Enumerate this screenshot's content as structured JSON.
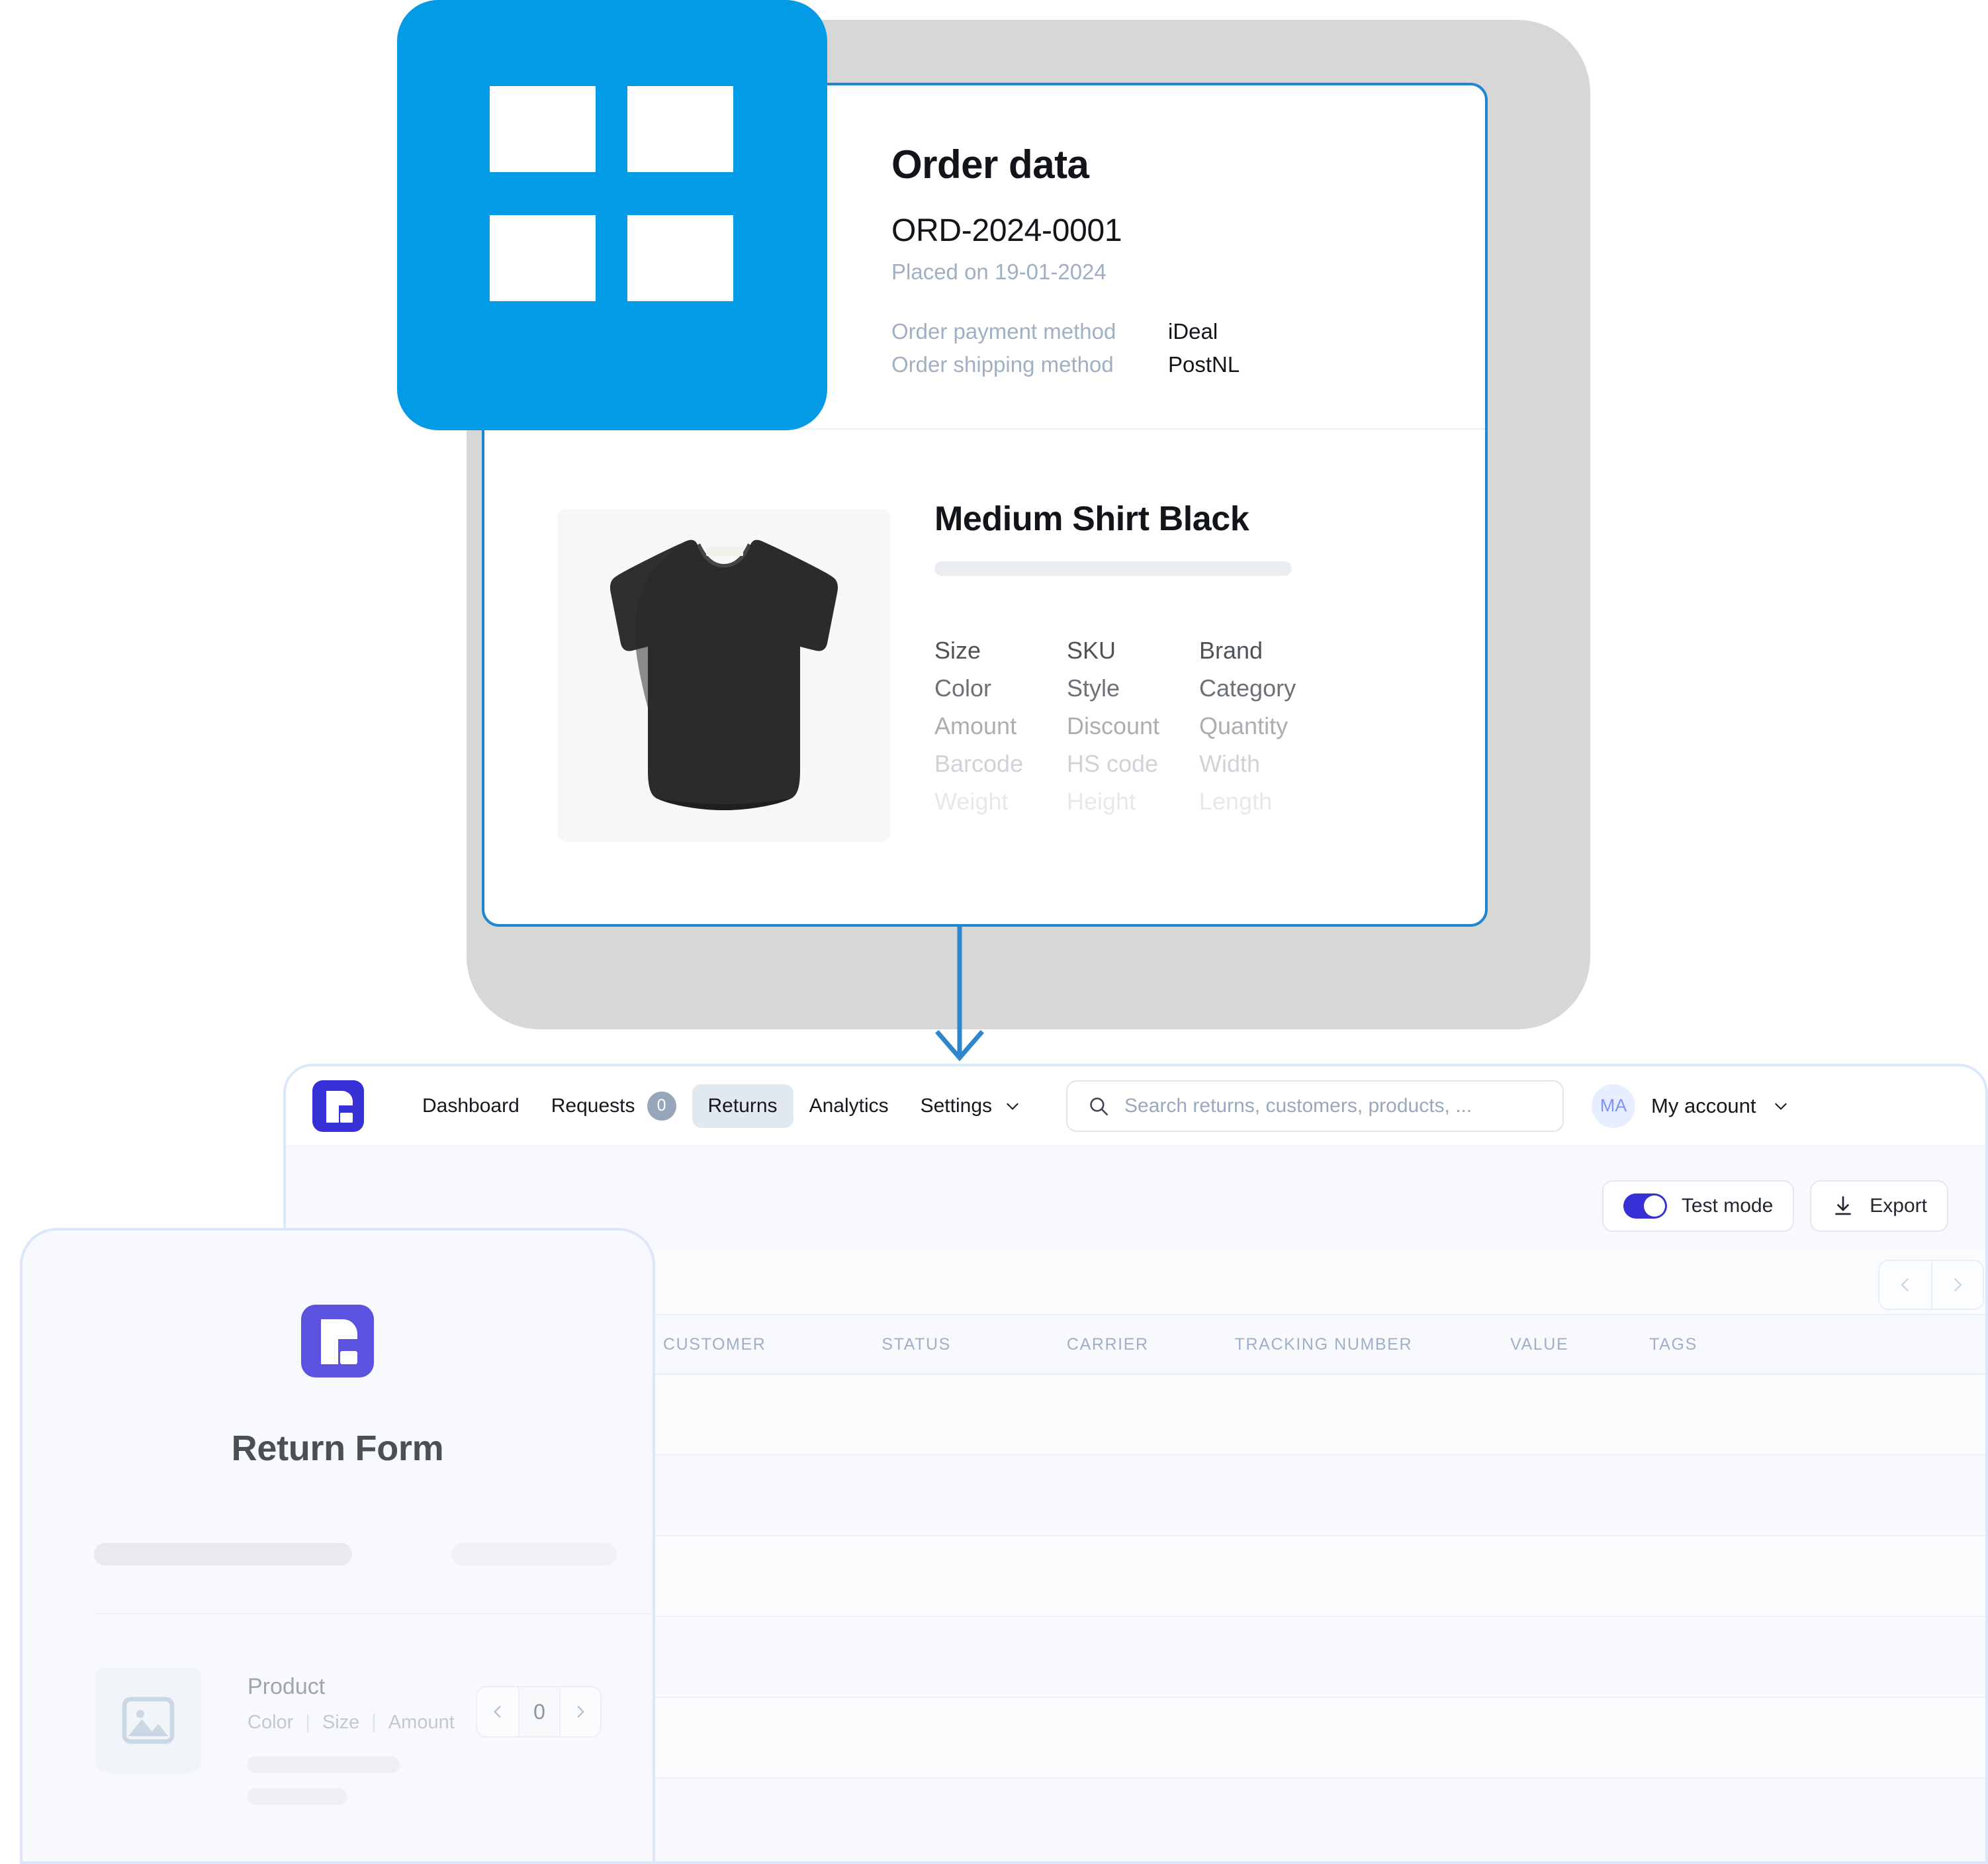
{
  "order_card": {
    "title": "Order data",
    "order_number": "ORD-2024-0001",
    "placed": "Placed on 19-01-2024",
    "meta": [
      {
        "key": "Order payment method",
        "value": "iDeal"
      },
      {
        "key": "Order shipping method",
        "value": "PostNL"
      }
    ],
    "product": {
      "name": "Medium Shirt Black",
      "attributes": [
        "Size",
        "SKU",
        "Brand",
        "Color",
        "Style",
        "Category",
        "Amount",
        "Discount",
        "Quantity",
        "Barcode",
        "HS code",
        "Width",
        "Weight",
        "Height",
        "Length"
      ]
    },
    "accent_color": "#1f87d0",
    "tile_color": "#039be5"
  },
  "dashboard": {
    "logo_icon": "returnless-logo-icon",
    "brand_color": "#3730d6",
    "nav": [
      {
        "label": "Dashboard",
        "active": false,
        "badge": null
      },
      {
        "label": "Requests",
        "active": false,
        "badge": "0"
      },
      {
        "label": "Returns",
        "active": true,
        "badge": null
      },
      {
        "label": "Analytics",
        "active": false,
        "badge": null
      },
      {
        "label": "Settings",
        "active": false,
        "badge": null,
        "caret": true
      }
    ],
    "search": {
      "placeholder": "Search returns, customers, products, ...",
      "value": ""
    },
    "account": {
      "initials": "MA",
      "label": "My account"
    },
    "toolbar": {
      "test_mode_label": "Test mode",
      "test_mode_on": true,
      "export_label": "Export"
    },
    "table": {
      "columns": [
        "CUSTOMER",
        "STATUS",
        "CARRIER",
        "TRACKING NUMBER",
        "VALUE",
        "TAGS"
      ],
      "rows": [
        [],
        [],
        []
      ]
    }
  },
  "return_form": {
    "title": "Return Form",
    "logo_icon": "returnless-logo-icon",
    "brand_color": "#5b52e0",
    "product": {
      "name": "Product",
      "attributes": [
        "Color",
        "Size",
        "Amount"
      ],
      "quantity": "0"
    }
  }
}
